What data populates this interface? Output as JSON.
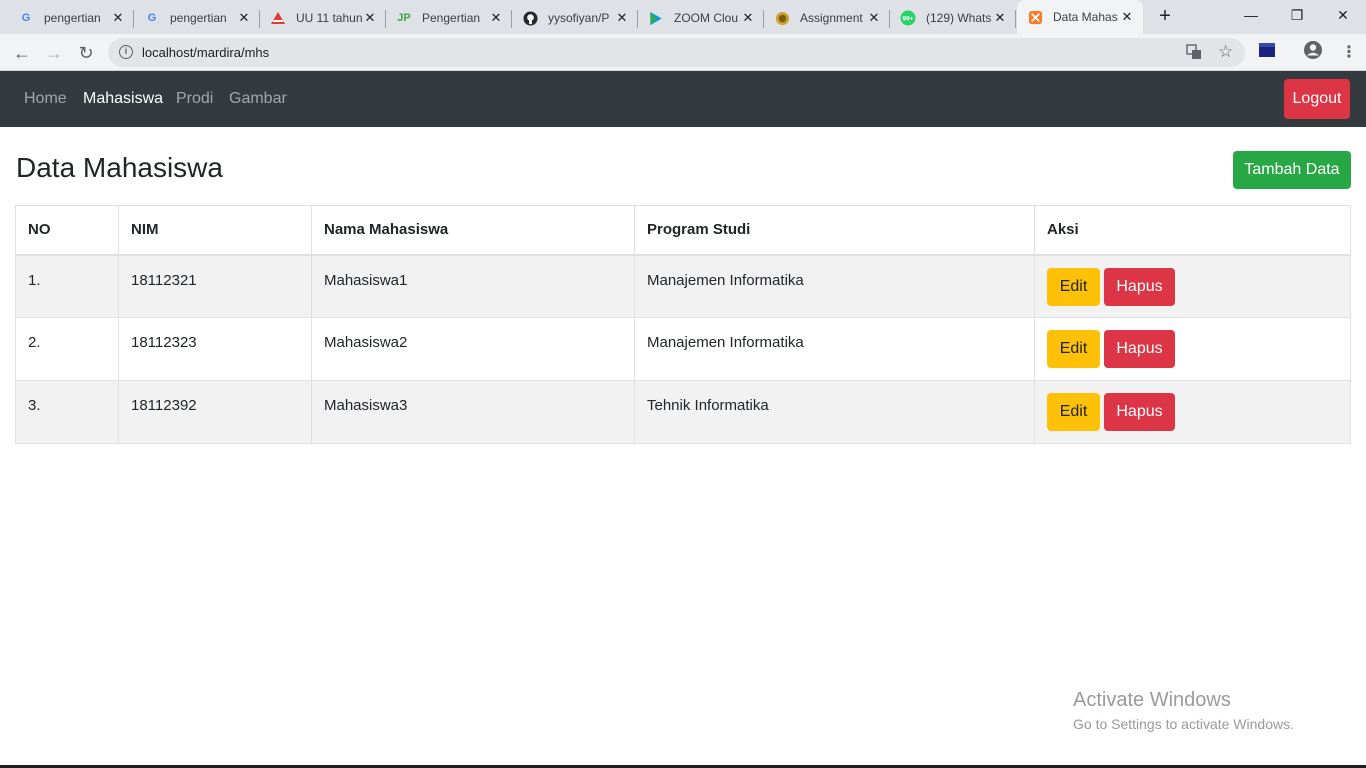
{
  "browser": {
    "tabs": [
      {
        "title": "pengertian",
        "icon": "google-icon"
      },
      {
        "title": "pengertian",
        "icon": "google-icon"
      },
      {
        "title": "UU 11 tahun",
        "icon": "document-icon"
      },
      {
        "title": "Pengertian",
        "icon": "jp-icon"
      },
      {
        "title": "yysofiyan/P",
        "icon": "github-icon"
      },
      {
        "title": "ZOOM Clou",
        "icon": "play-store-icon"
      },
      {
        "title": "Assignment",
        "icon": "assignment-icon"
      },
      {
        "title": "(129) Whats",
        "icon": "whatsapp-icon",
        "badge": "99+"
      },
      {
        "title": "Data Mahas",
        "icon": "xampp-icon",
        "active": true
      }
    ],
    "new_tab": "+",
    "url": "localhost/mardira/mhs"
  },
  "navbar": {
    "links": [
      "Home",
      "Mahasiswa",
      "Prodi",
      "Gambar"
    ],
    "active_link": "Mahasiswa",
    "logout_label": "Logout"
  },
  "page": {
    "title": "Data Mahasiswa",
    "add_button": "Tambah Data"
  },
  "table": {
    "headers": [
      "NO",
      "NIM",
      "Nama Mahasiswa",
      "Program Studi",
      "Aksi"
    ],
    "rows": [
      {
        "no": "1.",
        "nim": "18112321",
        "nama": "Mahasiswa1",
        "prodi": "Manajemen Informatika"
      },
      {
        "no": "2.",
        "nim": "18112323",
        "nama": "Mahasiswa2",
        "prodi": "Manajemen Informatika"
      },
      {
        "no": "3.",
        "nim": "18112392",
        "nama": "Mahasiswa3",
        "prodi": "Tehnik Informatika"
      }
    ],
    "edit_label": "Edit",
    "delete_label": "Hapus"
  },
  "watermark": {
    "line1": "Activate Windows",
    "line2": "Go to Settings to activate Windows."
  },
  "colors": {
    "navbar_bg": "#343a40",
    "danger": "#dc3545",
    "success": "#28a745",
    "warning": "#ffc107"
  }
}
